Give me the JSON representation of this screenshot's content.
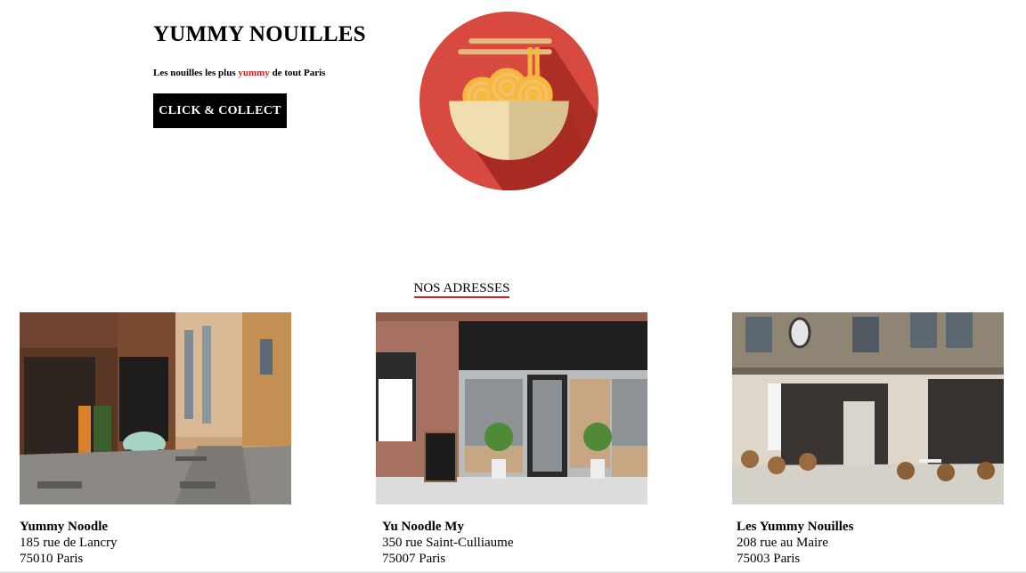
{
  "hero": {
    "title": "YUMMY NOUILLES",
    "tagline_before": "Les nouilles les plus ",
    "tagline_accent": "yummy",
    "tagline_after": " de tout Paris",
    "cta_label": "CLICK & COLLECT"
  },
  "colors": {
    "accent": "#d81e1e",
    "logo_circle": "#d84a3f",
    "button_bg": "#000000"
  },
  "icons": {
    "logo": "noodle-bowl-icon"
  },
  "section": {
    "title": "NOS ADRESSES"
  },
  "addresses": [
    {
      "name": "Yummy Noodle",
      "street": "185 rue de Lancry",
      "city": "75010 Paris"
    },
    {
      "name": "Yu Noodle My",
      "street": "350 rue Saint-Culliaume",
      "city": "75007 Paris"
    },
    {
      "name": "Les Yummy Nouilles",
      "street": "208 rue au Maire",
      "city": "75003 Paris"
    }
  ]
}
